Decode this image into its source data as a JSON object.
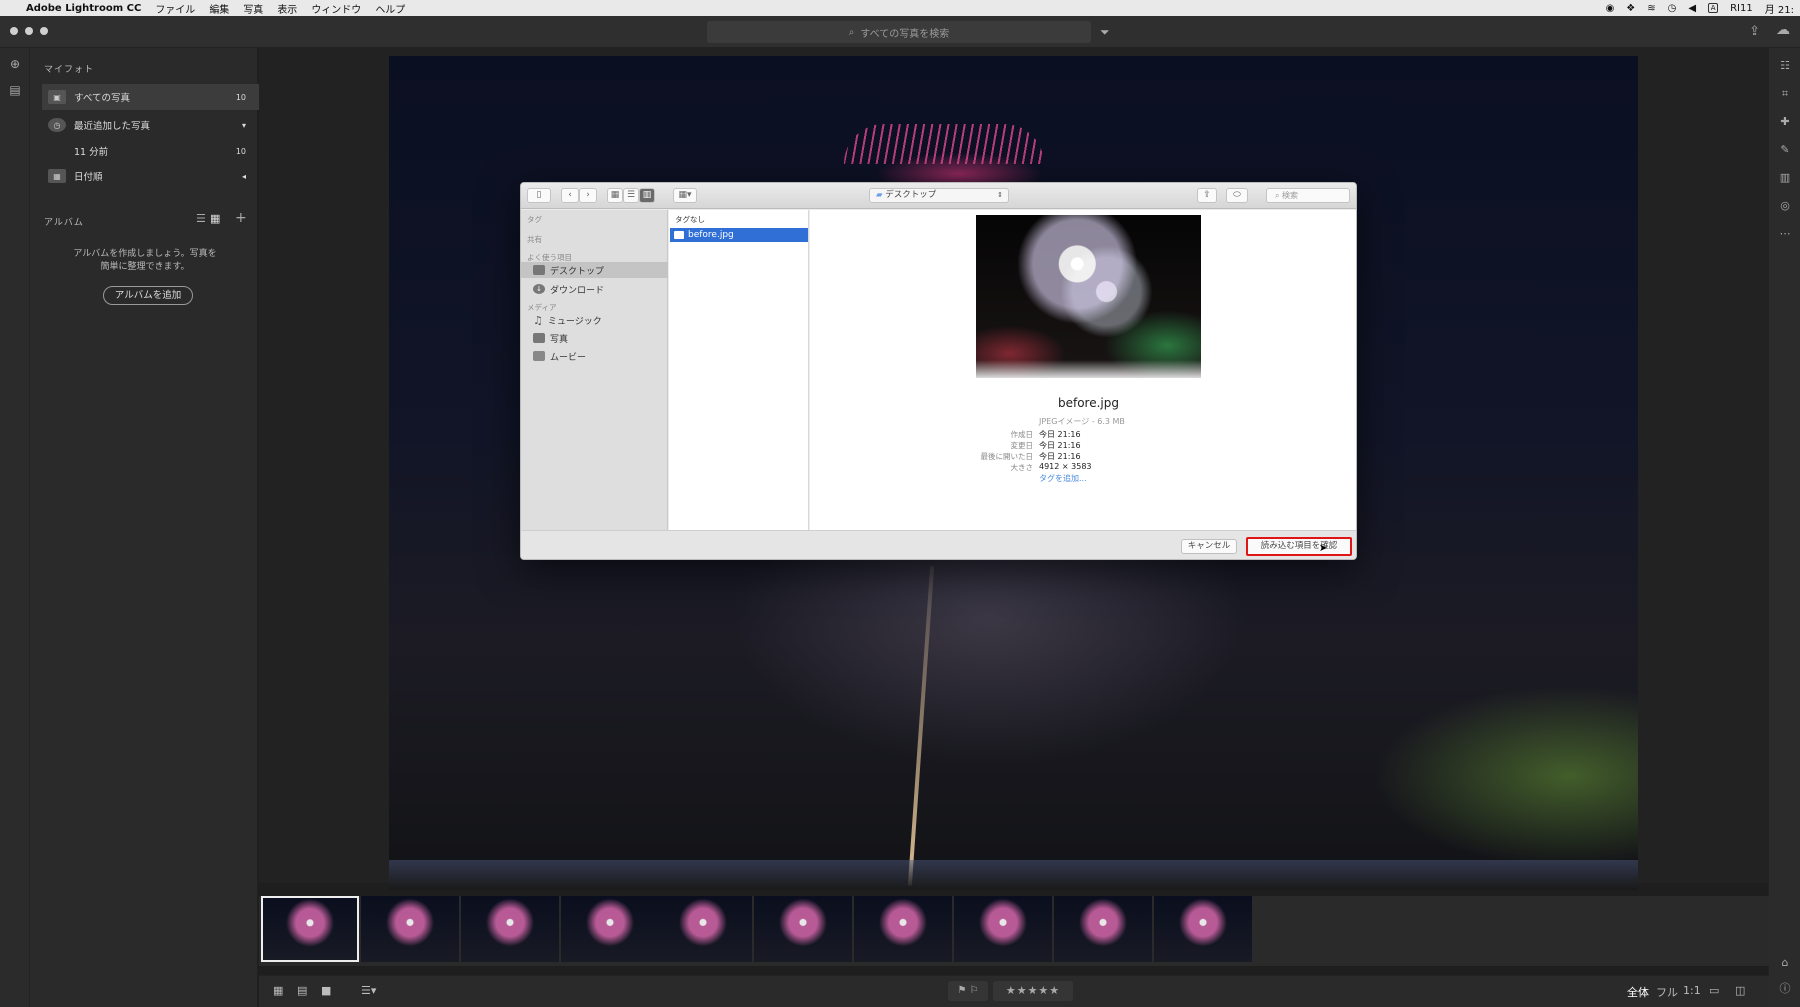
{
  "menubar": {
    "app_name": "Adobe Lightroom CC",
    "items": [
      "ファイル",
      "編集",
      "写真",
      "表示",
      "ウィンドウ",
      "ヘルプ"
    ],
    "right_text": "RI11",
    "clock": "月 21:",
    "keyboard": "A"
  },
  "titlebar": {
    "search_placeholder": "すべての写真を検索"
  },
  "sidebar": {
    "my_photos_header": "マイフォト",
    "all_photos": {
      "label": "すべての写真",
      "count": "10"
    },
    "recent": {
      "label": "最近追加した写真"
    },
    "recent_sub": {
      "label": "11 分前",
      "count": "10"
    },
    "by_date": {
      "label": "日付順"
    },
    "albums_header": "アルバム",
    "albums_empty_text": "アルバムを作成しましょう。写真を簡単に整理できます。",
    "add_album_button": "アルバムを追加"
  },
  "dialog": {
    "location": "デスクトップ",
    "search_placeholder": "検索",
    "side": {
      "tags": "タグ",
      "shared": "共有",
      "favorites": "よく使う項目",
      "desktop": "デスクトップ",
      "downloads": "ダウンロード",
      "media": "メディア",
      "music": "ミュージック",
      "photos": "写真",
      "movies": "ムービー"
    },
    "column_header": "タグなし",
    "selected_file": "before.jpg",
    "preview": {
      "filename": "before.jpg",
      "kind": "JPEGイメージ - 6.3 MB",
      "created_label": "作成日",
      "created": "今日 21:16",
      "modified_label": "変更日",
      "modified": "今日 21:16",
      "opened_label": "最後に開いた日",
      "opened": "今日 21:16",
      "size_label": "大きさ",
      "size": "4912 × 3583",
      "add_tag": "タグを追加..."
    },
    "cancel_button": "キャンセル",
    "confirm_button": "読み込む項目を確認"
  },
  "bottombar": {
    "view_all": "全体",
    "view_full": "フル",
    "view_1to1": "1:1",
    "stars": "★★★★★"
  },
  "icons": {
    "accent_red": "#e01515",
    "selection_blue": "#2f6fd6"
  }
}
